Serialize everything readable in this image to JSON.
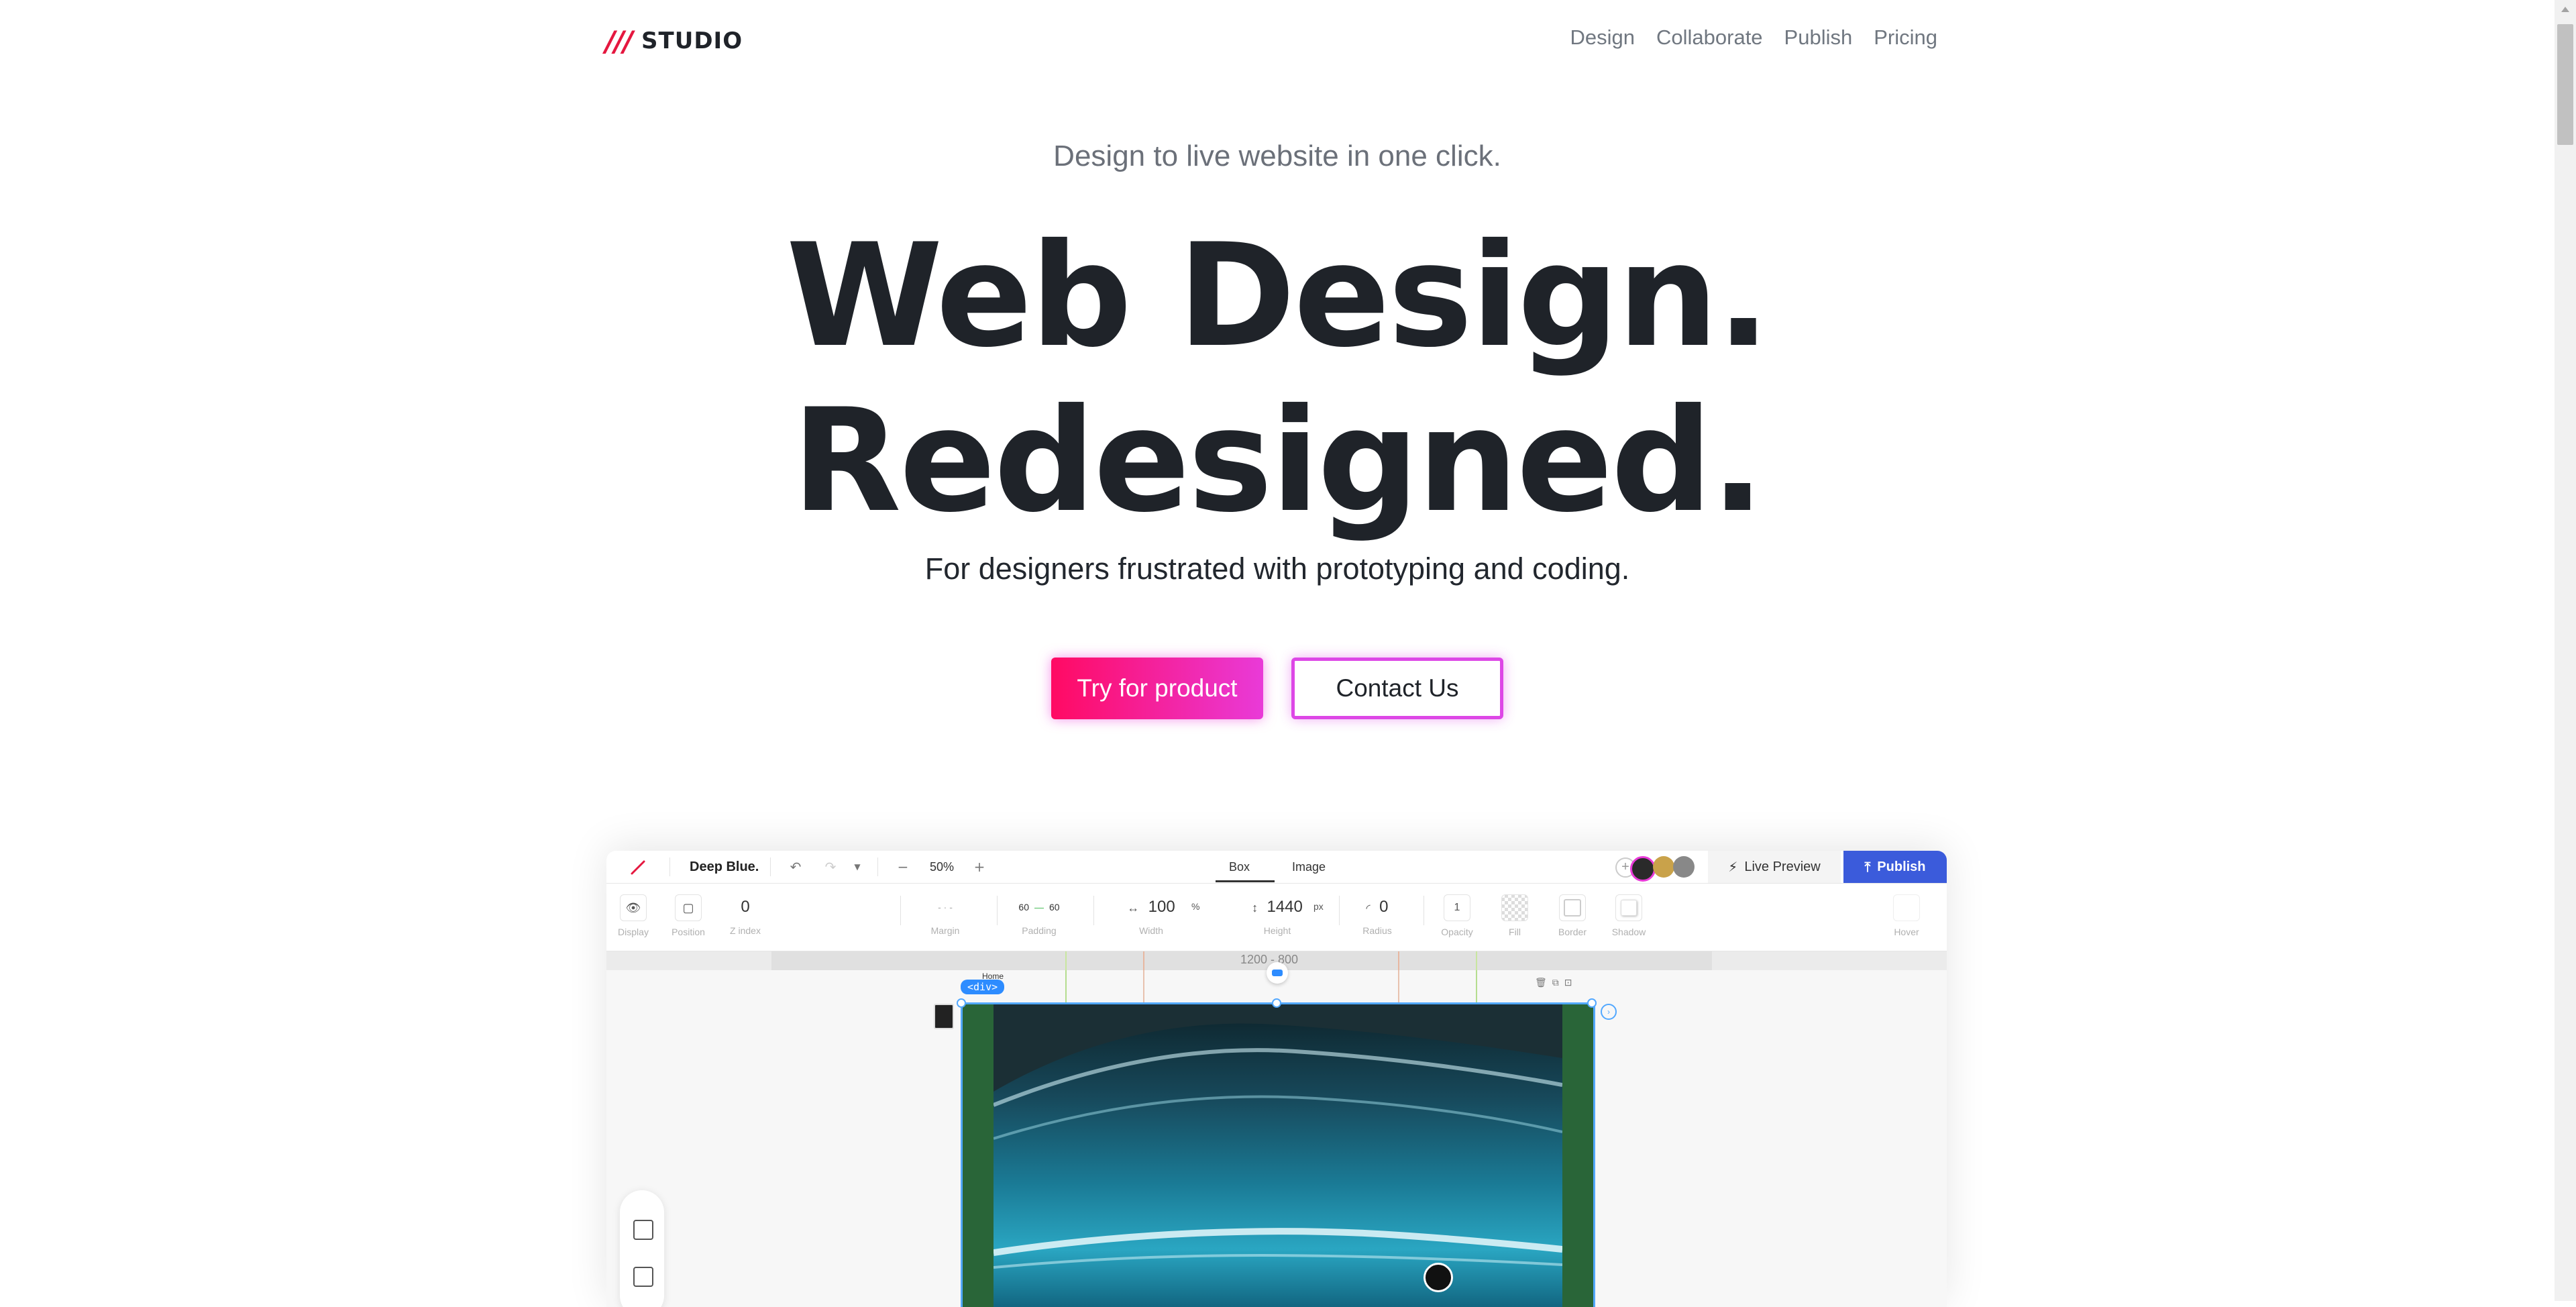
{
  "brand": {
    "slashes": "///",
    "name": "STUDIO",
    "accent": "#e5173f"
  },
  "nav": {
    "links": [
      "Design",
      "Collaborate",
      "Publish",
      "Pricing"
    ]
  },
  "hero": {
    "tagline": "Design to live website in one click.",
    "headline_1": "Web Design.",
    "headline_2": "Redesigned.",
    "subline": "For designers frustrated with prototyping and coding.",
    "primary_cta": "Try for product",
    "secondary_cta": "Contact Us",
    "gradient_start": "#ff0a63",
    "gradient_end": "#e93ad8"
  },
  "editor": {
    "project_name": "Deep Blue.",
    "zoom": "50%",
    "tabs": [
      "Box",
      "Image"
    ],
    "live_preview": "Live Preview",
    "publish": "Publish",
    "publish_color": "#3b5bdb",
    "props": {
      "display_label": "Display",
      "position_label": "Position",
      "zindex_value": "0",
      "zindex_label": "Z index",
      "margin_label": "Margin",
      "padding_left": "60",
      "padding_right": "60",
      "padding_label": "Padding",
      "width_value": "100",
      "width_unit": "%",
      "width_label": "Width",
      "height_value": "1440",
      "height_unit": "px",
      "height_label": "Height",
      "radius_value": "0",
      "radius_label": "Radius",
      "opacity_value": "1",
      "opacity_label": "Opacity",
      "fill_label": "Fill",
      "border_label": "Border",
      "shadow_label": "Shadow",
      "hover_label": "Hover"
    },
    "ruler_text": "1200 - 800",
    "element_tag": "<div>",
    "element_name": "Home"
  }
}
